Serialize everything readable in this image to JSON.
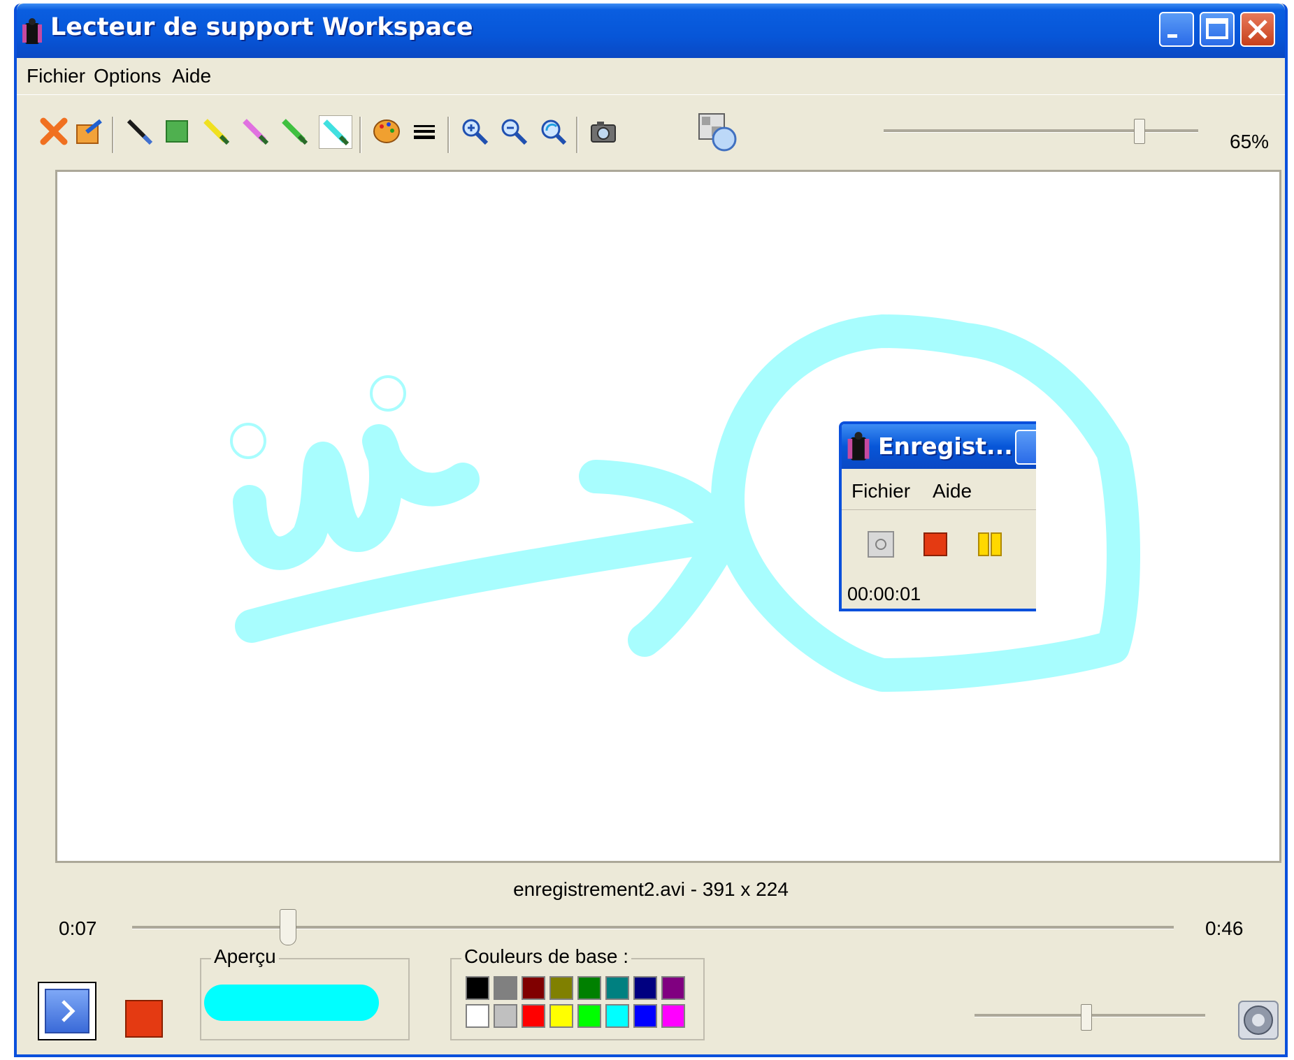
{
  "window": {
    "title": "Lecteur de support Workspace"
  },
  "menu": [
    "Fichier",
    "Options",
    "Aide"
  ],
  "toolbar": {
    "tools": [
      "delete-icon",
      "open-icon",
      "pointer-icon",
      "grid-icon",
      "yellow-pen-icon",
      "pink-pen-icon",
      "green-pen-icon",
      "cyan-pen-icon",
      "palette-icon",
      "line-width-icon",
      "zoom-in-icon",
      "zoom-out-icon",
      "refresh-icon",
      "camera-icon",
      "zoom-fit-icon"
    ],
    "zoom_label": "65%",
    "zoom_level_percent": 65
  },
  "recorder": {
    "title": "Enregist...",
    "menu": [
      "Fichier",
      "Aide"
    ],
    "time": "00:00:01"
  },
  "playback": {
    "file_label": "enregistrement2.avi - 391 x 224",
    "current_time": "0:07",
    "total_time": "0:46"
  },
  "preview": {
    "label": "Aperçu",
    "color": "#00ffff"
  },
  "base_colors": {
    "label": "Couleurs de base :",
    "row1": [
      "#000000",
      "#808080",
      "#800000",
      "#808000",
      "#008000",
      "#008080",
      "#000080",
      "#800080"
    ],
    "row2": [
      "#ffffff",
      "#c0c0c0",
      "#ff0000",
      "#ffff00",
      "#00ff00",
      "#00ffff",
      "#0000ff",
      "#ff00ff"
    ]
  },
  "colors": {
    "titlebar": "#0756d8",
    "ink": "#a8fdfe",
    "stop": "#e43a12"
  }
}
